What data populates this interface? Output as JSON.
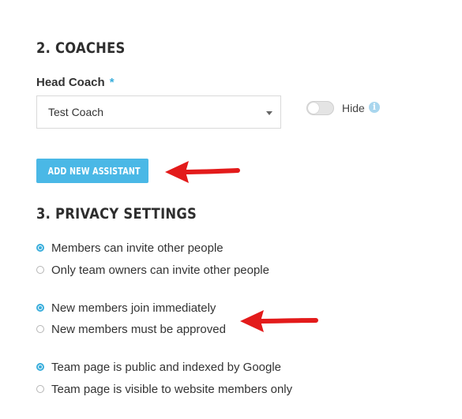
{
  "coaches": {
    "section_title": "2. COACHES",
    "head_coach_label": "Head Coach",
    "required_marker": "*",
    "head_coach_value": "Test Coach",
    "hide_toggle_on": false,
    "hide_label": "Hide",
    "info_glyph": "i",
    "add_assistant_label": "ADD NEW ASSISTANT"
  },
  "privacy": {
    "section_title": "3. PRIVACY SETTINGS",
    "invite": {
      "options": [
        {
          "label": "Members can invite other people",
          "selected": true
        },
        {
          "label": "Only team owners can invite other people",
          "selected": false
        }
      ]
    },
    "join": {
      "options": [
        {
          "label": "New members join immediately",
          "selected": true
        },
        {
          "label": "New members must be approved",
          "selected": false
        }
      ]
    },
    "visibility": {
      "options": [
        {
          "label": "Team page is public and indexed by Google",
          "selected": true
        },
        {
          "label": "Team page is visible to website members only",
          "selected": false
        }
      ]
    }
  },
  "colors": {
    "accent": "#3aaedc",
    "button": "#4ab8e6",
    "annotation_arrow": "#e31b1b"
  },
  "icons": {
    "select_caret": "chevron-down-icon",
    "info": "info-icon",
    "annotation": "red-arrow-icon"
  }
}
